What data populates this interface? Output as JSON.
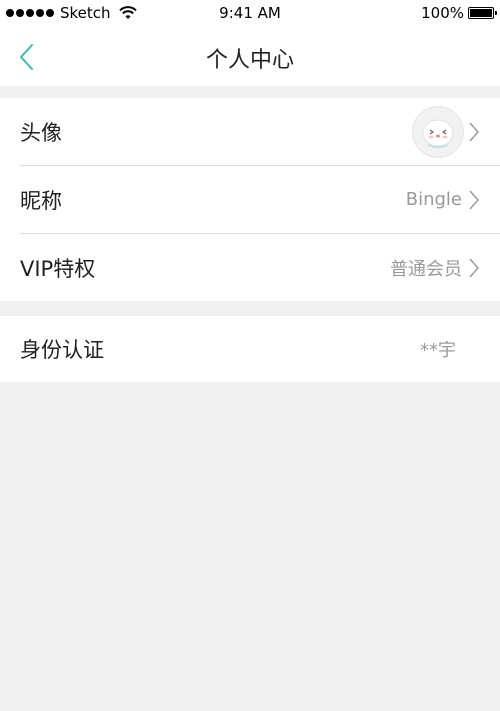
{
  "status_bar": {
    "carrier": "Sketch",
    "time": "9:41 AM",
    "battery": "100%"
  },
  "nav": {
    "title": "个人中心"
  },
  "profile": {
    "avatar_label": "头像",
    "nickname_label": "昵称",
    "nickname_value": "Bingle",
    "vip_label": "VIP特权",
    "vip_value": "普通会员"
  },
  "identity": {
    "label": "身份认证",
    "value": "**宇"
  },
  "colors": {
    "accent": "#3fb8b0",
    "background": "#efefef",
    "secondary_text": "#9a9a9a"
  },
  "icons": [
    "wifi-icon",
    "battery-icon",
    "back-arrow-icon",
    "chevron-right-icon",
    "avatar-image"
  ]
}
